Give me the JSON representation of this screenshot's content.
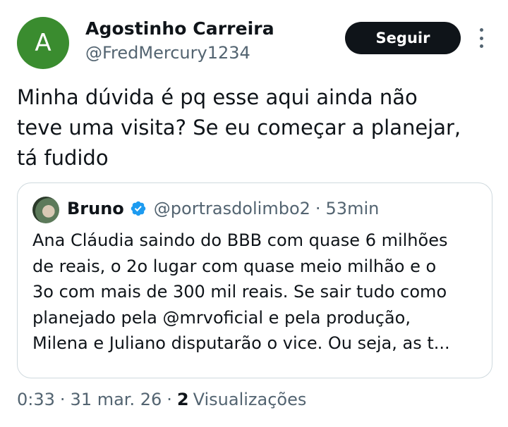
{
  "author": {
    "avatar_initial": "A",
    "avatar_color": "#3a8c2f",
    "name": "Agostinho Carreira",
    "handle": "@FredMercury1234"
  },
  "actions": {
    "follow_label": "Seguir",
    "more_icon": "more-vertical-icon"
  },
  "tweet": {
    "lines": [
      "Minha dúvida é pq esse aqui ainda não",
      "teve uma visita? Se eu começar a planejar,",
      "tá fudido"
    ]
  },
  "quote": {
    "name": "Bruno",
    "verified_icon": "verified-badge-icon",
    "verified_color": "#1d9bf0",
    "handle": "@portrasdolimbo2",
    "separator": "·",
    "time": "53min",
    "lines": [
      "Ana Cláudia saindo do BBB com quase 6 milhões",
      "de reais, o 2o lugar com quase meio milhão e o",
      "3o com mais de 300 mil reais. Se sair tudo como",
      "planejado pela @mrvoficial e pela produção,",
      "Milena e Juliano disputarão o vice. Ou seja, as t..."
    ]
  },
  "meta": {
    "time": "0:33",
    "separator": "·",
    "date": "31 mar. 26",
    "views_count": "2",
    "views_label": "Visualizações"
  }
}
